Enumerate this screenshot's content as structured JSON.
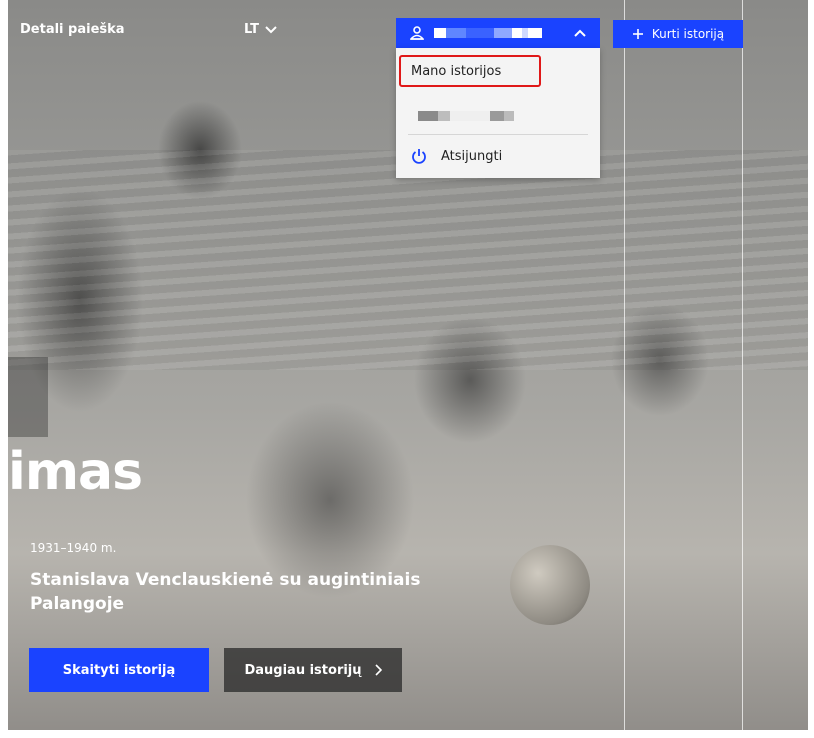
{
  "header": {
    "detail_search": "Detali paieška",
    "language": "LT",
    "create_button": "Kurti istoriją"
  },
  "user_menu": {
    "items": [
      {
        "label": "Mano istorijos"
      },
      {
        "label": "Atsijungti"
      }
    ]
  },
  "hero": {
    "title_fragment": "imas",
    "date": "1931–1940 m.",
    "subtitle": "Stanislava Venclauskienė su augintiniais Palangoje",
    "read_button": "Skaityti istoriją",
    "more_button": "Daugiau istorijų"
  },
  "colors": {
    "accent": "#1a43ff",
    "highlight": "#e01818"
  }
}
